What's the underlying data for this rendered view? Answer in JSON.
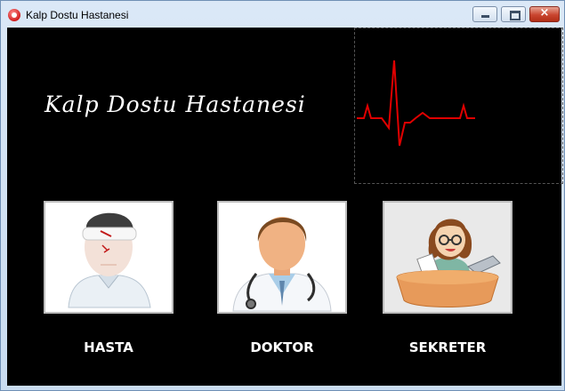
{
  "window": {
    "title": "Kalp Dostu Hastanesi",
    "controls": {
      "minimize": "minimize-icon",
      "maximize": "maximize-icon",
      "close": "×"
    }
  },
  "header": {
    "hospital_name": "Kalp Dostu Hastanesi",
    "ecg_color": "#e00000"
  },
  "roles": [
    {
      "label": "HASTA",
      "icon": "patient-icon"
    },
    {
      "label": "DOKTOR",
      "icon": "doctor-icon"
    },
    {
      "label": "SEKRETER",
      "icon": "secretary-icon"
    }
  ],
  "colors": {
    "background": "#000000",
    "label": "#ffffff"
  }
}
